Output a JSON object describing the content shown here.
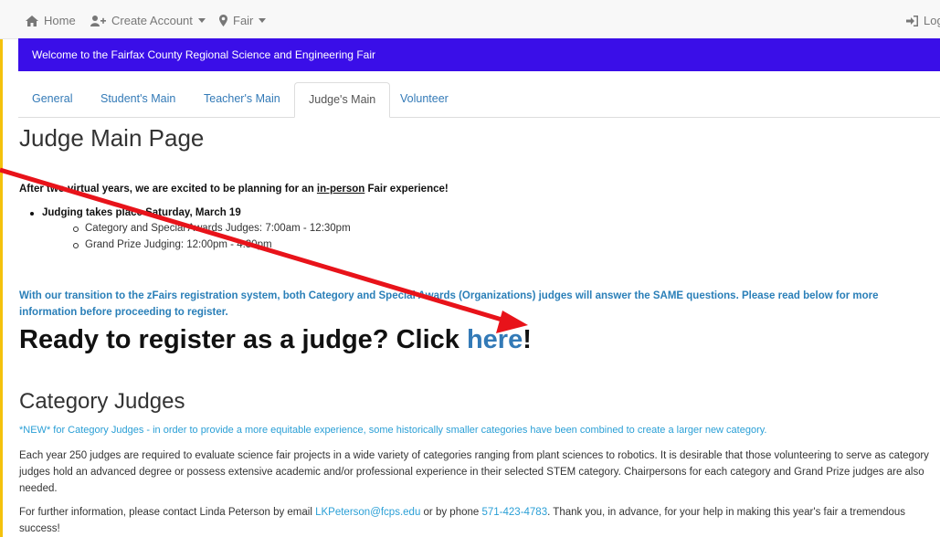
{
  "topnav": {
    "home_label": "Home",
    "create_account_label": "Create Account",
    "fair_label": "Fair",
    "login_label": "Log"
  },
  "banner": {
    "text": "Welcome to the Fairfax County Regional Science and Engineering Fair"
  },
  "tabs": [
    {
      "label": "General"
    },
    {
      "label": "Student's Main"
    },
    {
      "label": "Teacher's Main"
    },
    {
      "label": "Judge's Main"
    },
    {
      "label": "Volunteer"
    }
  ],
  "main": {
    "title": "Judge Main Page",
    "intro_before": "After two virtual years, we are excited to be planning for an ",
    "intro_underlined": "in-person",
    "intro_after": " Fair experience!",
    "judging_date": "Judging takes place Saturday, March 19",
    "sub_items": [
      "Category and Special Awards Judges: 7:00am - 12:30pm",
      "Grand Prize Judging: 12:00pm - 4:30pm"
    ],
    "transition_text": "With our transition to the zFairs registration system, both Category and Special Awards (Organizations) judges will answer the SAME questions. Please read below for more information before proceeding to register.",
    "ready_before": "Ready to register as a judge? Click ",
    "ready_link": "here",
    "ready_after": "!"
  },
  "category": {
    "title": "Category Judges",
    "new_note": "*NEW* for Category Judges - in order to provide a more equitable experience, some historically smaller categories have been combined to create a larger new category.",
    "para1": "Each year 250 judges are required to evaluate science fair projects in a wide variety of categories ranging from plant sciences to robotics. It is desirable that those volunteering to serve as category judges hold an advanced degree or possess extensive academic and/or professional experience in their selected STEM category. Chairpersons for each category and Grand Prize judges are also needed.",
    "para2_before": "For further information, please contact Linda Peterson by email ",
    "email": "LKPeterson@fcps.edu",
    "para2_mid": " or by phone ",
    "phone": "571-423-4783",
    "para2_after": ". Thank you, in advance, for your help in making this year's fair a tremendous success!"
  },
  "colors": {
    "banner_bg": "#3a0ee8",
    "link": "#337ab7",
    "arrow": "#e8131a"
  }
}
